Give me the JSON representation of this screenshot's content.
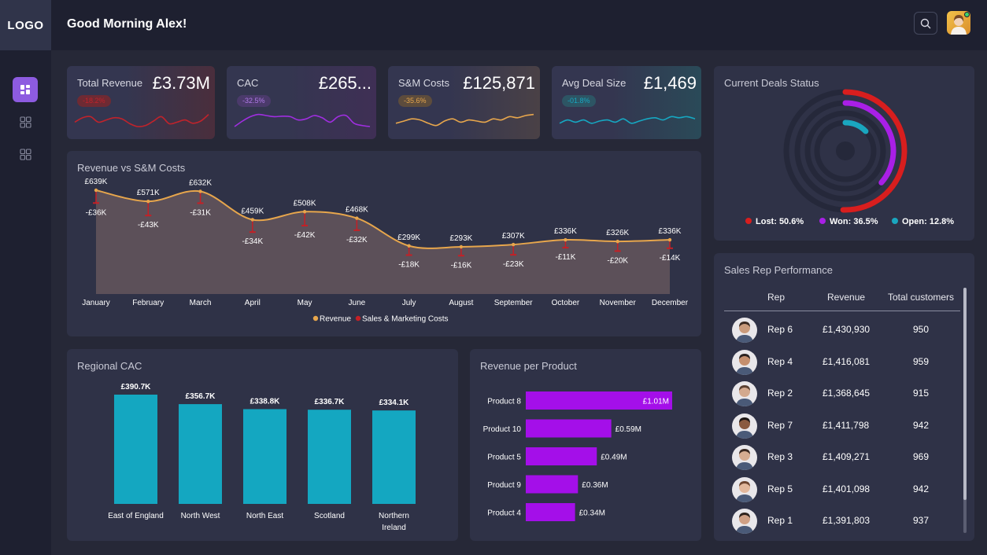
{
  "app": {
    "logo": "LOGO",
    "greeting": "Good Morning Alex!"
  },
  "icons": {
    "search": "search-icon",
    "nav": [
      "dashboard-icon",
      "grid-icon",
      "grid-icon"
    ]
  },
  "kpis": [
    {
      "label": "Total Revenue",
      "value": "£3.73M",
      "change": "-18.2%",
      "color": "#c0232b",
      "spark": [
        0.55,
        0.35,
        0.3,
        0.55,
        0.45,
        0.35,
        0.4,
        0.62,
        0.75,
        0.7,
        0.5,
        0.3,
        0.62,
        0.55,
        0.45,
        0.6,
        0.5,
        0.2
      ]
    },
    {
      "label": "CAC",
      "value": "£265...",
      "change": "-32.5%",
      "color": "#a02ee0",
      "spark": [
        0.75,
        0.5,
        0.3,
        0.2,
        0.25,
        0.3,
        0.28,
        0.3,
        0.45,
        0.4,
        0.25,
        0.35,
        0.55,
        0.3,
        0.25,
        0.6,
        0.7,
        0.75
      ]
    },
    {
      "label": "S&M Costs",
      "value": "£125,871",
      "change": "-35.6%",
      "color": "#e7a64c",
      "spark": [
        0.6,
        0.5,
        0.4,
        0.45,
        0.6,
        0.7,
        0.5,
        0.4,
        0.55,
        0.45,
        0.5,
        0.55,
        0.4,
        0.45,
        0.3,
        0.35,
        0.25,
        0.2
      ]
    },
    {
      "label": "Avg Deal Size",
      "value": "£1,469",
      "change": "-01.8%",
      "color": "#16a8c2",
      "spark": [
        0.6,
        0.45,
        0.55,
        0.45,
        0.6,
        0.5,
        0.45,
        0.55,
        0.4,
        0.6,
        0.5,
        0.4,
        0.35,
        0.45,
        0.3,
        0.35,
        0.3,
        0.4
      ]
    }
  ],
  "revenue_chart": {
    "title": "Revenue vs S&M Costs",
    "legend": [
      "Revenue",
      "Sales & Marketing Costs"
    ],
    "revenue_color": "#e7a64c",
    "cost_color": "#c42026"
  },
  "deals": {
    "title": "Current Deals Status",
    "segments": [
      {
        "label": "Lost",
        "value": 50.6,
        "display": "Lost: 50.6%",
        "color": "#d81e1e"
      },
      {
        "label": "Won",
        "value": 36.5,
        "display": "Won: 36.5%",
        "color": "#a91fe6"
      },
      {
        "label": "Open",
        "value": 12.8,
        "display": "Open: 12.8%",
        "color": "#1aa6bf"
      }
    ]
  },
  "regional": {
    "title": "Regional CAC",
    "color": "#14a7c1"
  },
  "products": {
    "title": "Revenue per Product",
    "color": "#a40fe9"
  },
  "reps": {
    "title": "Sales Rep Performance",
    "columns": [
      "Rep",
      "Revenue",
      "Total customers"
    ],
    "rows": [
      {
        "rep": "Rep 6",
        "revenue": "£1,430,930",
        "customers": "950"
      },
      {
        "rep": "Rep 4",
        "revenue": "£1,416,081",
        "customers": "959"
      },
      {
        "rep": "Rep 2",
        "revenue": "£1,368,645",
        "customers": "915"
      },
      {
        "rep": "Rep 7",
        "revenue": "£1,411,798",
        "customers": "942"
      },
      {
        "rep": "Rep 3",
        "revenue": "£1,409,271",
        "customers": "969"
      },
      {
        "rep": "Rep 5",
        "revenue": "£1,401,098",
        "customers": "942"
      },
      {
        "rep": "Rep 1",
        "revenue": "£1,391,803",
        "customers": "937"
      }
    ]
  },
  "chart_data": [
    {
      "type": "area",
      "title": "Revenue vs S&M Costs",
      "categories": [
        "January",
        "February",
        "March",
        "April",
        "May",
        "June",
        "July",
        "August",
        "September",
        "October",
        "November",
        "December"
      ],
      "series": [
        {
          "name": "Revenue",
          "values": [
            639,
            571,
            632,
            459,
            508,
            468,
            299,
            293,
            307,
            336,
            326,
            336
          ],
          "labels": [
            "£639K",
            "£571K",
            "£632K",
            "£459K",
            "£508K",
            "£468K",
            "£299K",
            "£293K",
            "£307K",
            "£336K",
            "£326K",
            "£336K"
          ]
        },
        {
          "name": "Sales & Marketing Costs",
          "values": [
            -36,
            -43,
            -31,
            -34,
            -42,
            -32,
            -18,
            -16,
            -23,
            -11,
            -20,
            -14
          ],
          "labels": [
            "-£36K",
            "-£43K",
            "-£31K",
            "-£34K",
            "-£42K",
            "-£32K",
            "-£18K",
            "-£16K",
            "-£23K",
            "-£11K",
            "-£20K",
            "-£14K"
          ]
        }
      ]
    },
    {
      "type": "bar",
      "title": "Regional CAC",
      "categories": [
        "East of England",
        "North West",
        "North East",
        "Scotland",
        "Northern Ireland"
      ],
      "values": [
        390.7,
        356.7,
        338.8,
        336.7,
        334.1
      ],
      "labels": [
        "£390.7K",
        "£356.7K",
        "£338.8K",
        "£336.7K",
        "£334.1K"
      ]
    },
    {
      "type": "bar",
      "title": "Revenue per Product",
      "orientation": "horizontal",
      "categories": [
        "Product 8",
        "Product 10",
        "Product 5",
        "Product 9",
        "Product 4"
      ],
      "values": [
        1.01,
        0.59,
        0.49,
        0.36,
        0.34
      ],
      "labels": [
        "£1.01M",
        "£0.59M",
        "£0.49M",
        "£0.36M",
        "£0.34M"
      ]
    },
    {
      "type": "pie",
      "title": "Current Deals Status",
      "categories": [
        "Lost",
        "Won",
        "Open"
      ],
      "values": [
        50.6,
        36.5,
        12.8
      ]
    }
  ]
}
